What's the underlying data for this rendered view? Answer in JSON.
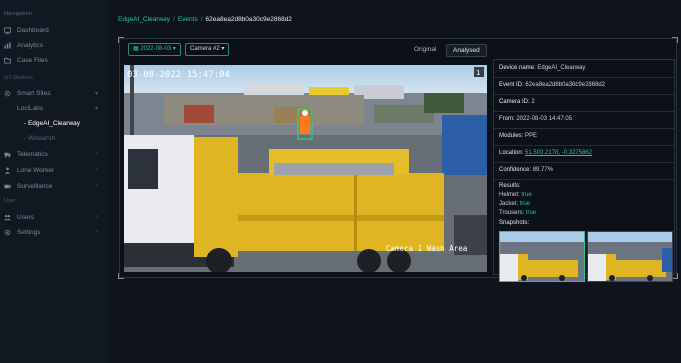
{
  "sidebar": {
    "heading": "Navigation",
    "items": [
      {
        "label": "Dashboard"
      },
      {
        "label": "Analytics"
      },
      {
        "label": "Case Files"
      }
    ],
    "devices_heading": "IoT Devices",
    "devices": [
      {
        "label": "Smart Sites"
      },
      {
        "label": "LociLabs"
      },
      {
        "label": "- EdgeAI_Clearway"
      },
      {
        "label": "- Winsersh"
      },
      {
        "label": "Telematics"
      },
      {
        "label": "Lone Worker"
      },
      {
        "label": "Surveillance"
      }
    ],
    "user_heading": "User",
    "user_items": [
      {
        "label": "Users"
      },
      {
        "label": "Settings"
      }
    ]
  },
  "breadcrumb": {
    "part1": "EdgeAI_Clearway",
    "part2": "Events",
    "current": "62ea8ea2d8b0a30c9e2868d2",
    "sep": "/"
  },
  "toolbar": {
    "date": "2022-08-03 ▾",
    "camera": "Camera #2 ▾",
    "tab_original": "Original",
    "tab_analysed": "Analysed"
  },
  "image": {
    "timestamp": "03-08-2022 15:47:04",
    "caption": "Camera 1 Wash Area",
    "badge": "1"
  },
  "details": {
    "device_label": "Device name:",
    "device_value": "EdgeAI_Clearway",
    "event_label": "Event ID:",
    "event_value": "62ea8ea2d8b0a30c9e2868d2",
    "camera_label": "Camera ID:",
    "camera_value": "2",
    "from_label": "From:",
    "from_value": "2022-08-03 14:47:05",
    "modules_label": "Modules:",
    "modules_value": "PPE",
    "location_label": "Location:",
    "location_value": "51.503.2178, -0.3275862",
    "confidence_label": "Confidence:",
    "confidence_value": "89.77%",
    "results_label": "Results:",
    "results": [
      {
        "label": "Helmet:",
        "value": "true"
      },
      {
        "label": "Jacket:",
        "value": "true"
      },
      {
        "label": "Trousers:",
        "value": "true"
      }
    ],
    "snapshots_label": "Snapshots:"
  },
  "colors": {
    "accent": "#2bc3a6",
    "truck_yellow": "#e0b524",
    "background": "#0f141c"
  }
}
